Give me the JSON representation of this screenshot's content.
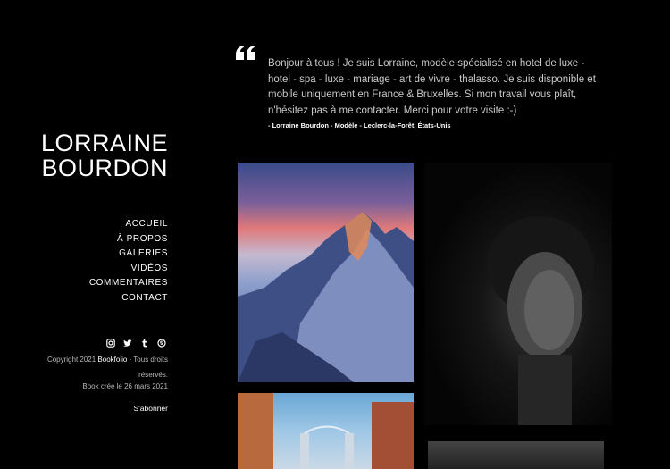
{
  "site": {
    "title_line1": "LORRAINE",
    "title_line2": "BOURDON"
  },
  "nav": {
    "items": [
      "ACCUEIL",
      "À PROPOS",
      "GALERIES",
      "VIDÉOS",
      "COMMENTAIRES",
      "CONTACT"
    ]
  },
  "social": {
    "icons": [
      "instagram-icon",
      "twitter-icon",
      "tumblr-icon",
      "skype-icon"
    ]
  },
  "footer": {
    "copyright_prefix": "Copyright 2021 ",
    "brand": "Bookfolio",
    "copyright_suffix": " - Tous droits réservés.",
    "created": "Book crée le 26 mars 2021",
    "subscribe": "S'abonner"
  },
  "quote": {
    "text": "Bonjour à tous ! Je suis Lorraine, modèle spécialisé en hotel de luxe - hotel - spa - luxe - mariage - art de vivre - thalasso. Je suis disponible et mobile uniquement en France & Bruxelles. Si mon travail vous plaît, n'hésitez pas à me contacter. Merci pour votre visite :-)",
    "author": "- Lorraine Bourdon - Modèle - Leclerc-la-Forêt, États-Unis"
  }
}
